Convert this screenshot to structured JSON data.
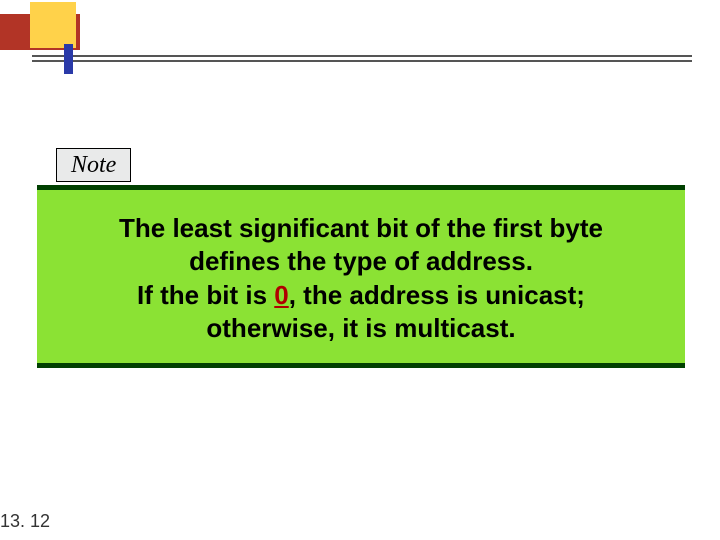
{
  "header": {
    "colors": {
      "yellow": "#ffd24a",
      "red": "#b23426",
      "blue": "#2a3aa8",
      "line": "#555555"
    }
  },
  "note": {
    "label": "Note"
  },
  "callout": {
    "line1": "The least significant bit of the first byte",
    "line2": "defines the type of address.",
    "line3_prefix": "If the bit is ",
    "line3_emph": "0",
    "line3_suffix": ", the address is unicast;",
    "line4": "otherwise, it is multicast.",
    "accent_color": "#b00000",
    "bg_color": "#8be234",
    "border_color": "#004000"
  },
  "footer": {
    "page_number": "13. 12"
  }
}
